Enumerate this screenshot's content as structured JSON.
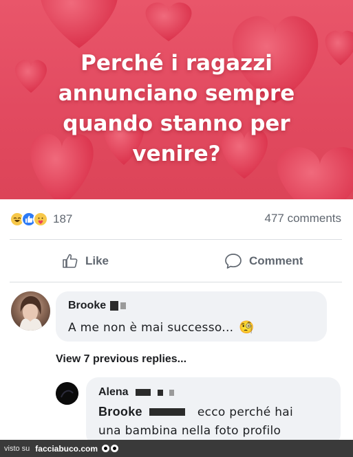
{
  "post": {
    "image_text_lines": [
      "Perché i ragazzi",
      "annunciano sempre",
      "quando stanno per",
      "venire?"
    ],
    "colors": {
      "background": "#e24a60",
      "hearts": "#e5374f"
    }
  },
  "stats": {
    "reaction_icons": [
      "haha-icon",
      "like-icon",
      "care-icon"
    ],
    "reaction_count": "187",
    "comment_count": "477 comments"
  },
  "actions": {
    "like_label": "Like",
    "comment_label": "Comment"
  },
  "comments": [
    {
      "author": "Brooke",
      "text": "A me non è mai successo...",
      "emoji": "🧐"
    }
  ],
  "view_replies_label": "View 7 previous replies...",
  "reply": {
    "author": "Alena",
    "mention": "Brooke",
    "text_line1": "ecco perché hai",
    "text_line2": "una bambina nella foto profilo"
  },
  "footer": {
    "prefix": "visto su",
    "brand": "facciabuco.com"
  }
}
